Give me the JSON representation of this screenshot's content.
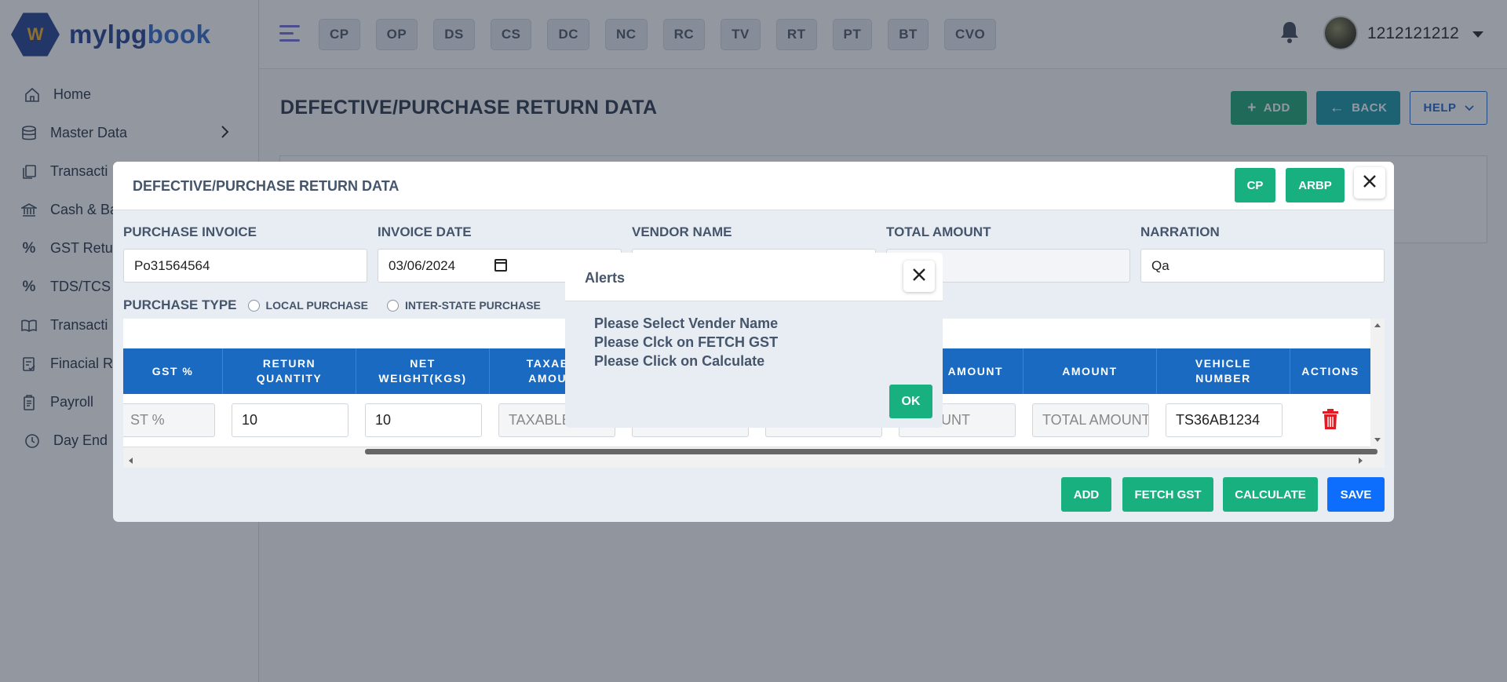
{
  "brand": {
    "mark": "W",
    "part1": "mylpg",
    "part2": "book"
  },
  "sidebar": {
    "items": [
      {
        "label": "Home",
        "icon": "home-icon"
      },
      {
        "label": "Master Data",
        "icon": "database-icon"
      },
      {
        "label": "Transacti",
        "icon": "copy-icon"
      },
      {
        "label": "Cash & Ba",
        "icon": "bank-icon"
      },
      {
        "label": "GST Retu",
        "icon": "percent-icon"
      },
      {
        "label": "TDS/TCS",
        "icon": "percent-icon"
      },
      {
        "label": "Transacti",
        "icon": "book-icon"
      },
      {
        "label": "Finacial R",
        "icon": "report-icon"
      },
      {
        "label": "Payroll",
        "icon": "clipboard-icon"
      },
      {
        "label": "Day End",
        "icon": "clock-icon"
      }
    ]
  },
  "topbar": {
    "chips": [
      "CP",
      "OP",
      "DS",
      "CS",
      "DC",
      "NC",
      "RC",
      "TV",
      "RT",
      "PT",
      "BT",
      "CVO"
    ],
    "user": "1212121212"
  },
  "page": {
    "title": "DEFECTIVE/PURCHASE RETURN DATA",
    "add_label": "ADD",
    "back_label": "BACK",
    "help_label": "HELP"
  },
  "modal": {
    "title": "DEFECTIVE/PURCHASE RETURN DATA",
    "cp_label": "CP",
    "arbp_label": "ARBP",
    "fields": {
      "purchase_invoice": {
        "label": "PURCHASE INVOICE",
        "value": "Po31564564"
      },
      "invoice_date": {
        "label": "INVOICE DATE",
        "value": "03/06/2024"
      },
      "vendor_name": {
        "label": "VENDOR NAME",
        "value": ""
      },
      "total_amount": {
        "label": "TOTAL AMOUNT",
        "value": ""
      },
      "narration": {
        "label": "NARRATION",
        "value": "Qa"
      }
    },
    "purchase_type": {
      "label": "PURCHASE TYPE",
      "options": [
        "LOCAL PURCHASE",
        "INTER-STATE PURCHASE"
      ]
    },
    "table": {
      "headers": [
        "GST %",
        "RETURN QUANTITY",
        "NET WEIGHT(KGS)",
        "TAXABLE AMOUNT",
        "",
        "",
        "AMOUNT",
        "AMOUNT",
        "VEHICLE NUMBER",
        "ACTIONS"
      ],
      "row": {
        "gst": "ST %",
        "return_qty": "10",
        "net_weight": "10",
        "taxable": "TAXABLE",
        "amount1": "AMOUNT",
        "total_amount": "TOTAL AMOUNT",
        "vehicle": "TS36AB1234"
      }
    },
    "buttons": {
      "add": "ADD",
      "fetch_gst": "FETCH GST",
      "calculate": "CALCULATE",
      "save": "SAVE"
    }
  },
  "alert": {
    "title": "Alerts",
    "messages": [
      "Please Select Vender Name",
      "Please Clck on FETCH GST",
      "Please Click on Calculate"
    ],
    "ok_label": "OK"
  }
}
